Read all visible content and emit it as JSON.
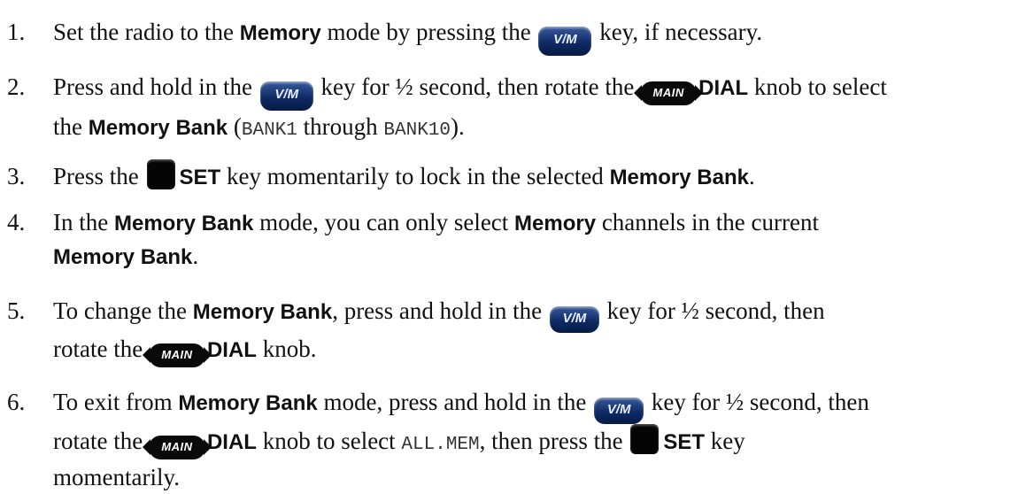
{
  "steps": [
    {
      "num": "1.",
      "a": "Set the radio to the ",
      "b1": "Memory",
      "c": " mode by pressing the ",
      "key": "V/M",
      "d": " key, if necessary."
    },
    {
      "num": "2.",
      "a": "Press and hold in the ",
      "key": "V/M",
      "b": " key for ½ second, then rotate the ",
      "knob": "MAIN",
      "dial": "DIAL",
      "c": " knob to select",
      "d": "the ",
      "bold": "Memory Bank",
      "e": " (",
      "m1": "BANK1",
      "f": " through ",
      "m2": "BANK10",
      "g": ")."
    },
    {
      "num": "3.",
      "a": "Press the ",
      "set": "SET",
      "b": " key momentarily to lock in the selected ",
      "bold": "Memory Bank",
      "c": "."
    },
    {
      "num": "4.",
      "a": "In the ",
      "b1": "Memory Bank",
      "b": " mode, you can only select ",
      "b2": "Memory",
      "c": " channels in the current",
      "b3": "Memory Bank",
      "d": "."
    },
    {
      "num": "5.",
      "a": "To change the ",
      "b1": "Memory Bank",
      "b": ", press and hold in the ",
      "key": "V/M",
      "c": " key for ½ second, then",
      "d": "rotate the ",
      "knob": "MAIN",
      "dial": "DIAL",
      "e": " knob."
    },
    {
      "num": "6.",
      "a": "To exit from ",
      "b1": "Memory Bank",
      "b": " mode, press and hold in the ",
      "key": "V/M",
      "c": " key for ½ second, then",
      "d": "rotate the ",
      "knob": "MAIN",
      "dial": "DIAL",
      "e": " knob to select ",
      "mono": "ALL.MEM",
      "f": ", then press the ",
      "set": "SET",
      "g": " key",
      "h": "momentarily."
    }
  ],
  "colors": {
    "key_blue": "#0e2b66",
    "set_key": "#050505",
    "text": "#111111"
  },
  "icons": {
    "vm_key": "vm-key-icon",
    "set_key": "set-key-icon",
    "main_dial": "main-dial-icon"
  }
}
